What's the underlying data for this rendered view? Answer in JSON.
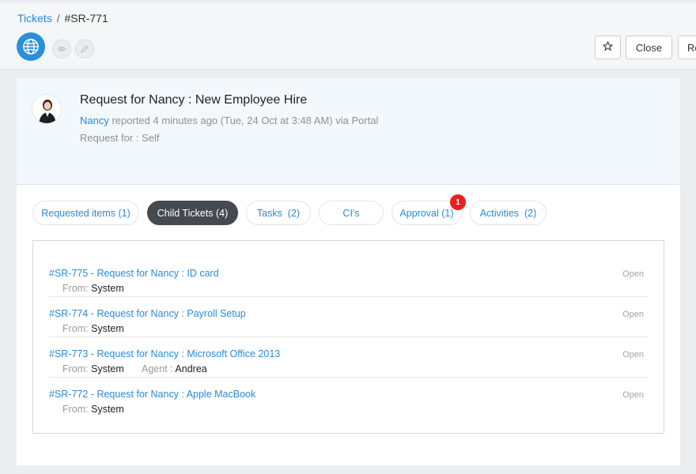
{
  "breadcrumb": {
    "parent": "Tickets",
    "separator": "/",
    "current": "#SR-771"
  },
  "header": {
    "icons": [
      "globe-icon",
      "eye-icon",
      "pencil-icon",
      "star-icon"
    ],
    "close_label": "Close",
    "next_label": "Re"
  },
  "ticket": {
    "title": "Request for Nancy : New Employee Hire",
    "requester": "Nancy",
    "reported_text": " reported 4 minutes ago (Tue, 24 Oct at 3:48 AM) via Portal",
    "request_for": "Request for : Self"
  },
  "tabs": [
    {
      "label": "Requested items (1)"
    },
    {
      "label": "Child Tickets (4)",
      "active": true
    },
    {
      "label": "Tasks  (2)"
    },
    {
      "label": "CI's"
    },
    {
      "label": "Approval (1)",
      "badge": "1"
    },
    {
      "label": "Activities  (2)"
    }
  ],
  "child_tickets": [
    {
      "title": "#SR-775 - Request for Nancy : ID card",
      "from_label": "From:",
      "from": "System",
      "status": "Open"
    },
    {
      "title": "#SR-774 - Request for Nancy : Payroll Setup",
      "from_label": "From:",
      "from": "System",
      "status": "Open"
    },
    {
      "title": "#SR-773 - Request for Nancy : Microsoft Office 2013",
      "from_label": "From:",
      "from": "System",
      "agent_label": "Agent :",
      "agent": "Andrea",
      "status": "Open"
    },
    {
      "title": "#SR-772 - Request for Nancy : Apple MacBook",
      "from_label": "From:",
      "from": "System",
      "status": "Open"
    }
  ],
  "colors": {
    "accent": "#2c8ad4",
    "active_tab": "#454a50",
    "badge": "#e82020"
  }
}
